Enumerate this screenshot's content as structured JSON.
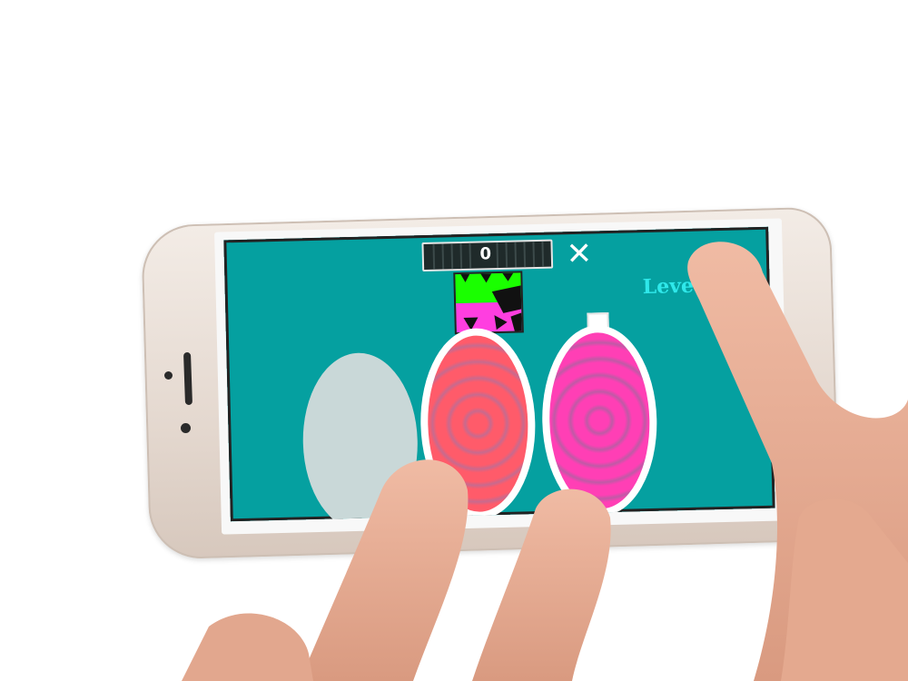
{
  "game": {
    "score": "0",
    "close_label": "✕",
    "level_label": "Leve"
  },
  "colors": {
    "background": "#05a0a0",
    "level_text": "#2fe8ea",
    "plate_red": "#ff5b6a",
    "plate_pink": "#ff3fb5",
    "piece_green": "#1aff00",
    "piece_pink": "#ff3ee0"
  },
  "icons": {
    "close": "close-icon"
  }
}
